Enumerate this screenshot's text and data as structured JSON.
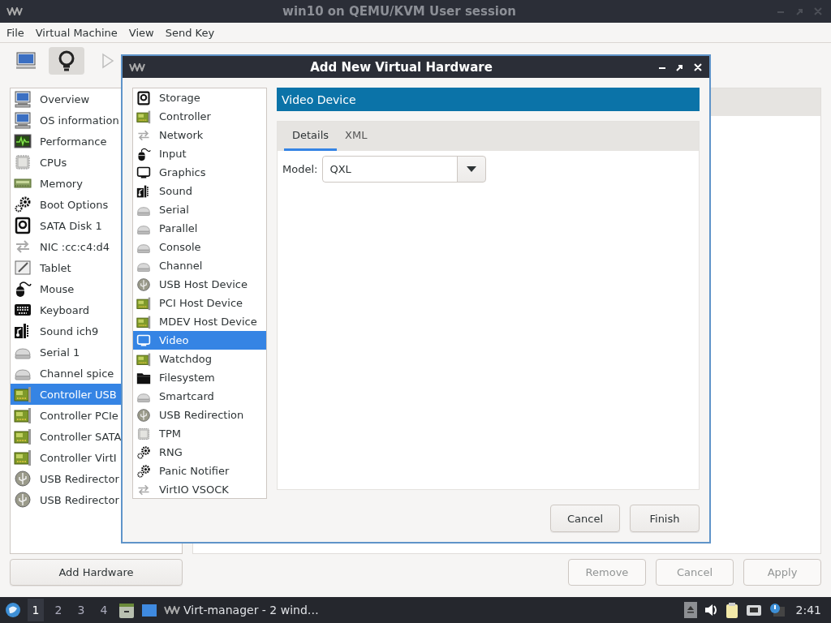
{
  "window": {
    "title": "win10 on QEMU/KVM User session",
    "active": false
  },
  "menu": [
    "File",
    "Virtual Machine",
    "View",
    "Send Key"
  ],
  "toolbar": [
    {
      "selected": false,
      "disabled": false
    },
    {
      "selected": true,
      "disabled": false
    },
    {
      "selected": false,
      "disabled": true
    }
  ],
  "hardware_list": [
    {
      "label": "Overview",
      "selected": false
    },
    {
      "label": "OS information",
      "selected": false
    },
    {
      "label": "Performance",
      "selected": false
    },
    {
      "label": "CPUs",
      "selected": false
    },
    {
      "label": "Memory",
      "selected": false
    },
    {
      "label": "Boot Options",
      "selected": false
    },
    {
      "label": "SATA Disk 1",
      "selected": false
    },
    {
      "label": "NIC :cc:c4:d4",
      "selected": false
    },
    {
      "label": "Tablet",
      "selected": false
    },
    {
      "label": "Mouse",
      "selected": false
    },
    {
      "label": "Keyboard",
      "selected": false
    },
    {
      "label": "Sound ich9",
      "selected": false
    },
    {
      "label": "Serial 1",
      "selected": false
    },
    {
      "label": "Channel spice",
      "selected": false
    },
    {
      "label": "Controller USB",
      "selected": true
    },
    {
      "label": "Controller PCIe",
      "selected": false
    },
    {
      "label": "Controller SATA",
      "selected": false
    },
    {
      "label": "Controller VirtI",
      "selected": false
    },
    {
      "label": "USB Redirector",
      "selected": false
    },
    {
      "label": "USB Redirector",
      "selected": false
    }
  ],
  "add_hardware_button": "Add Hardware",
  "actions": [
    {
      "label": "Remove",
      "disabled": true
    },
    {
      "label": "Cancel",
      "disabled": true
    },
    {
      "label": "Apply",
      "disabled": true
    }
  ],
  "dialog": {
    "title": "Add New Virtual Hardware",
    "device_types": [
      {
        "label": "Storage",
        "selected": false
      },
      {
        "label": "Controller",
        "selected": false
      },
      {
        "label": "Network",
        "selected": false
      },
      {
        "label": "Input",
        "selected": false
      },
      {
        "label": "Graphics",
        "selected": false
      },
      {
        "label": "Sound",
        "selected": false
      },
      {
        "label": "Serial",
        "selected": false
      },
      {
        "label": "Parallel",
        "selected": false
      },
      {
        "label": "Console",
        "selected": false
      },
      {
        "label": "Channel",
        "selected": false
      },
      {
        "label": "USB Host Device",
        "selected": false
      },
      {
        "label": "PCI Host Device",
        "selected": false
      },
      {
        "label": "MDEV Host Device",
        "selected": false
      },
      {
        "label": "Video",
        "selected": true
      },
      {
        "label": "Watchdog",
        "selected": false
      },
      {
        "label": "Filesystem",
        "selected": false
      },
      {
        "label": "Smartcard",
        "selected": false
      },
      {
        "label": "USB Redirection",
        "selected": false
      },
      {
        "label": "TPM",
        "selected": false
      },
      {
        "label": "RNG",
        "selected": false
      },
      {
        "label": "Panic Notifier",
        "selected": false
      },
      {
        "label": "VirtIO VSOCK",
        "selected": false
      }
    ],
    "header": "Video Device",
    "tabs": [
      {
        "label": "Details",
        "selected": true
      },
      {
        "label": "XML",
        "selected": false
      }
    ],
    "model_label": "Model:",
    "model_value": "QXL",
    "buttons": [
      "Cancel",
      "Finish"
    ]
  },
  "taskbar": {
    "workspaces": [
      {
        "label": "1",
        "selected": true
      },
      {
        "label": "2",
        "selected": false
      },
      {
        "label": "3",
        "selected": false
      },
      {
        "label": "4",
        "selected": false
      }
    ],
    "task": "Virt-manager - 2 wind…",
    "clock": "2:41"
  }
}
